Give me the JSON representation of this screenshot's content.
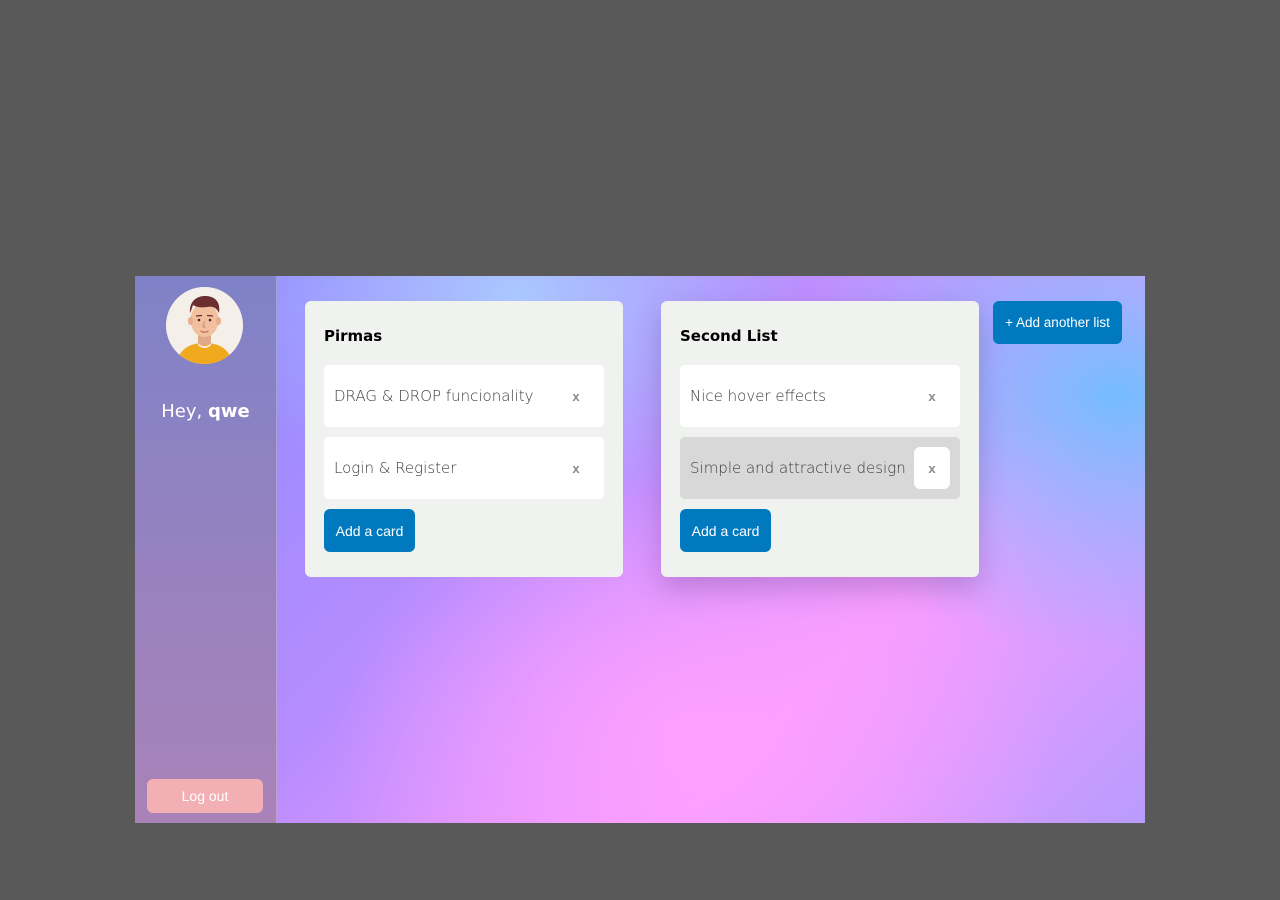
{
  "user": {
    "greeting_prefix": "Hey, ",
    "name": "qwe",
    "avatar_icon": "man-avatar-icon"
  },
  "sidebar": {
    "logout_label": "Log out"
  },
  "lists": [
    {
      "title": "Pirmas",
      "cards": [
        {
          "text": "DRAG & DROP funcionality",
          "remove": "x"
        },
        {
          "text": "Login & Register",
          "remove": "x"
        }
      ],
      "add_card_label": "Add a card"
    },
    {
      "title": "Second List",
      "cards": [
        {
          "text": "Nice hover effects",
          "remove": "x"
        },
        {
          "text": "Simple and attractive design",
          "remove": "x"
        }
      ],
      "add_card_label": "Add a card"
    }
  ],
  "board": {
    "add_list_label": "+ Add another list"
  },
  "colors": {
    "page_background": "#595959",
    "primary_button": "#0079bf",
    "logout_button": "#f2b0b4",
    "list_background": "#f0f2ef",
    "card_hover": "#d8d8d8"
  }
}
